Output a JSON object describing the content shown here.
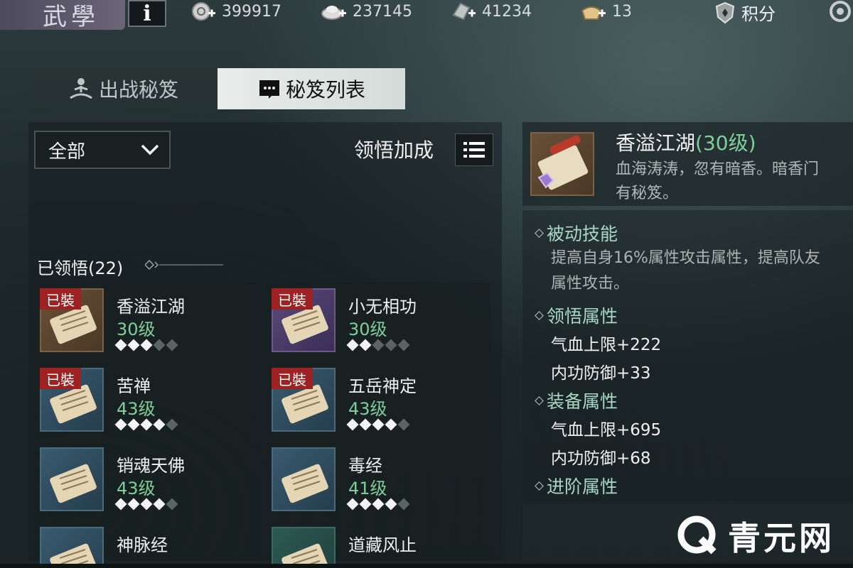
{
  "topbar": {
    "title": "武學",
    "info_label": "i",
    "resources": [
      {
        "icon": "coin-plus-icon",
        "value": "399917"
      },
      {
        "icon": "silver-plus-icon",
        "value": "237145"
      },
      {
        "icon": "jade-plus-icon",
        "value": "41234"
      },
      {
        "icon": "ingot-plus-icon",
        "value": "13"
      }
    ],
    "score_label": "积分"
  },
  "tabs": [
    {
      "label": "出战秘笈",
      "icon": "meditate-icon",
      "active": false
    },
    {
      "label": "秘笈列表",
      "icon": "book-icon",
      "active": true
    }
  ],
  "filter": {
    "selected": "全部"
  },
  "bonus_label": "领悟加成",
  "section": {
    "title": "已领悟(22)"
  },
  "cards": [
    {
      "name": "香溢江湖",
      "level": "30级",
      "equipped": true,
      "badge": "已裝",
      "stars": 3,
      "max_stars": 5,
      "theme": "brown"
    },
    {
      "name": "小无相功",
      "level": "30级",
      "equipped": true,
      "badge": "已裝",
      "stars": 2,
      "max_stars": 5,
      "theme": "purple"
    },
    {
      "name": "苦禅",
      "level": "43级",
      "equipped": true,
      "badge": "已裝",
      "stars": 4,
      "max_stars": 5,
      "theme": "blue"
    },
    {
      "name": "五岳神定",
      "level": "43级",
      "equipped": true,
      "badge": "已裝",
      "stars": 4,
      "max_stars": 5,
      "theme": "blue"
    },
    {
      "name": "销魂天佛",
      "level": "43级",
      "equipped": false,
      "badge": "",
      "stars": 4,
      "max_stars": 5,
      "theme": "blue"
    },
    {
      "name": "毒经",
      "level": "41级",
      "equipped": false,
      "badge": "",
      "stars": 4,
      "max_stars": 5,
      "theme": "blue"
    },
    {
      "name": "神脉经",
      "level": "",
      "equipped": false,
      "badge": "",
      "stars": 0,
      "max_stars": 0,
      "theme": "blue"
    },
    {
      "name": "道藏风止",
      "level": "",
      "equipped": false,
      "badge": "",
      "stars": 0,
      "max_stars": 0,
      "theme": "teal"
    }
  ],
  "detail": {
    "name": "香溢江湖",
    "level": "(30级)",
    "desc_line1": "血海涛涛，忽有暗香。暗香门",
    "desc_line2": "有秘笈。",
    "passive_title": "被动技能",
    "passive_line1": "提高自身16%属性攻击属性，提高队友",
    "passive_line2": "属性攻击。",
    "insight_title": "领悟属性",
    "insight_stats": [
      "气血上限+222",
      "内功防御+33"
    ],
    "equip_title": "装备属性",
    "equip_stats": [
      "气血上限+695",
      "内功防御+68"
    ],
    "advance_title": "进阶属性"
  },
  "watermark": {
    "text": "青元网"
  },
  "colors": {
    "level_green": "#7fcf9a",
    "badge_red": "#9e2222",
    "attr_head": "#a8d8c4"
  }
}
